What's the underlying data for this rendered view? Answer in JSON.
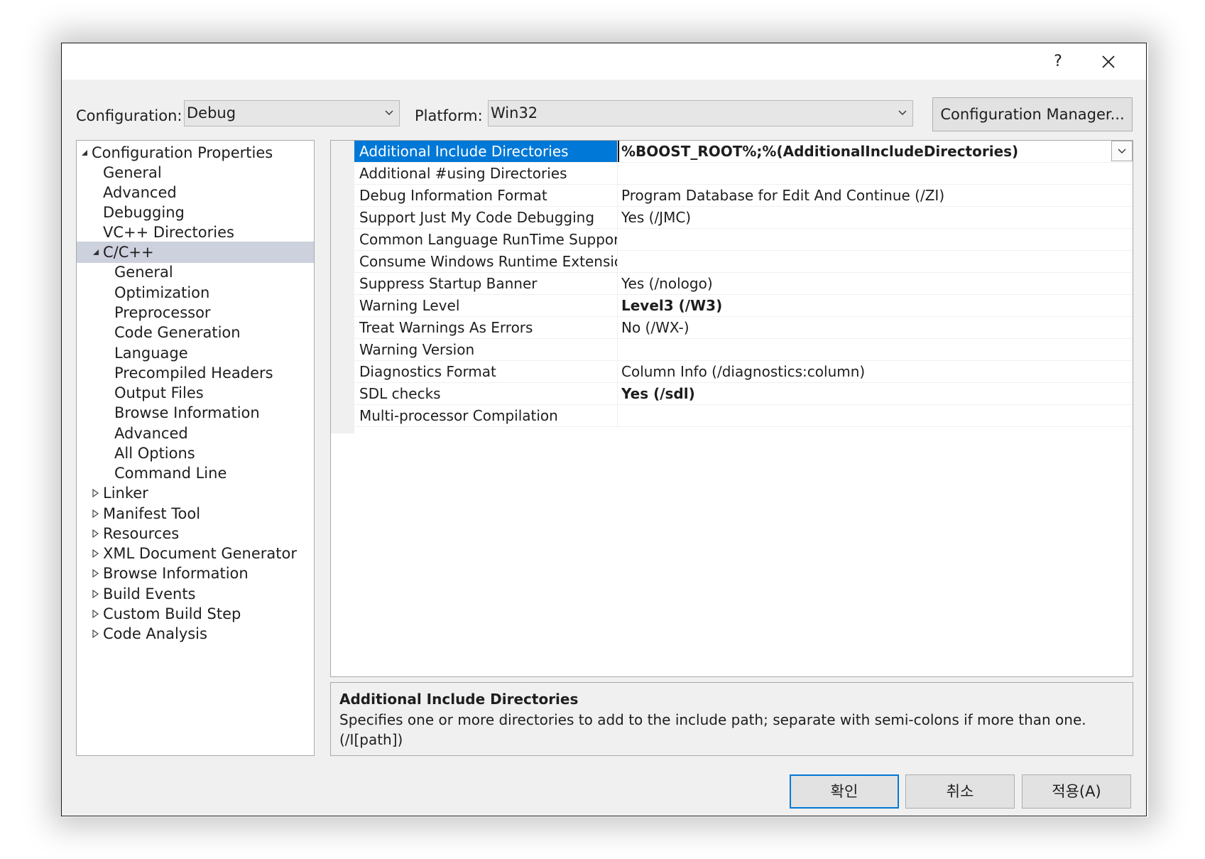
{
  "window": {
    "help_label": "?",
    "close_icon": "close-icon"
  },
  "config": {
    "configuration_label": "Configuration:",
    "configuration_value": "Debug",
    "platform_label": "Platform:",
    "platform_value": "Win32",
    "manager_button": "Configuration Manager..."
  },
  "tree": {
    "root": "Configuration Properties",
    "general": "General",
    "advanced": "Advanced",
    "debugging": "Debugging",
    "vc_dirs": "VC++ Directories",
    "cpp": "C/C++",
    "cpp_children": [
      "General",
      "Optimization",
      "Preprocessor",
      "Code Generation",
      "Language",
      "Precompiled Headers",
      "Output Files",
      "Browse Information",
      "Advanced",
      "All Options",
      "Command Line"
    ],
    "collapsed": [
      "Linker",
      "Manifest Tool",
      "Resources",
      "XML Document Generator",
      "Browse Information",
      "Build Events",
      "Custom Build Step",
      "Code Analysis"
    ]
  },
  "grid": {
    "rows": [
      {
        "name": "Additional Include Directories",
        "value": "%BOOST_ROOT%;%(AdditionalIncludeDirectories)",
        "bold": true
      },
      {
        "name": "Additional #using Directories",
        "value": "",
        "bold": false
      },
      {
        "name": "Debug Information Format",
        "value": "Program Database for Edit And Continue (/ZI)",
        "bold": false
      },
      {
        "name": "Support Just My Code Debugging",
        "value": "Yes (/JMC)",
        "bold": false
      },
      {
        "name": "Common Language RunTime Suppor",
        "value": "",
        "bold": false
      },
      {
        "name": "Consume Windows Runtime Extensio",
        "value": "",
        "bold": false
      },
      {
        "name": "Suppress Startup Banner",
        "value": "Yes (/nologo)",
        "bold": false
      },
      {
        "name": "Warning Level",
        "value": "Level3 (/W3)",
        "bold": true
      },
      {
        "name": "Treat Warnings As Errors",
        "value": "No (/WX-)",
        "bold": false
      },
      {
        "name": "Warning Version",
        "value": "",
        "bold": false
      },
      {
        "name": "Diagnostics Format",
        "value": "Column Info (/diagnostics:column)",
        "bold": false
      },
      {
        "name": "SDL checks",
        "value": "Yes (/sdl)",
        "bold": true
      },
      {
        "name": "Multi-processor Compilation",
        "value": "",
        "bold": false
      }
    ]
  },
  "description": {
    "title": "Additional Include Directories",
    "text": "Specifies one or more directories to add to the include path; separate with semi-colons if more than one. (/I[path])"
  },
  "buttons": {
    "ok": "확인",
    "cancel": "취소",
    "apply": "적용(A)"
  },
  "colors": {
    "selection": "#0078d7",
    "tree_selection": "#cdd1de",
    "dialog_bg": "#f0f0f0"
  }
}
